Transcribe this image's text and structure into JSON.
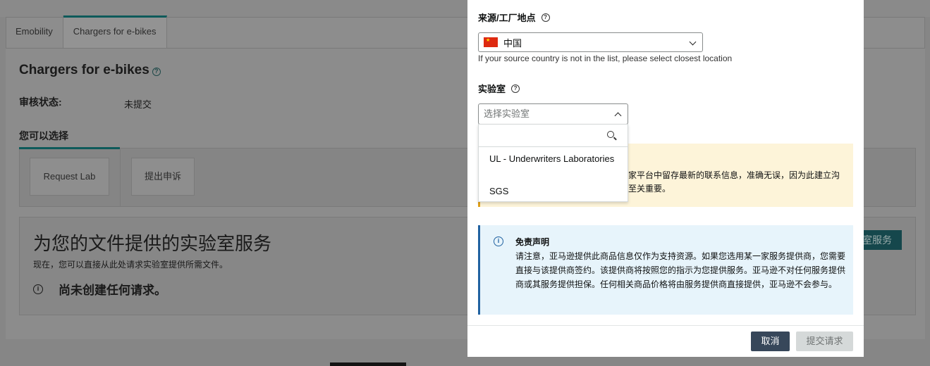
{
  "background": {
    "page_title": "",
    "tabs": [
      {
        "label": "Emobility"
      },
      {
        "label": "Chargers for e-bikes"
      }
    ],
    "heading": "Chargers for e-bikes",
    "review_status_label": "审核状态:",
    "review_status_value": "未提交",
    "you_can_choose": "您可以选择",
    "cards": [
      {
        "label": "Request Lab"
      },
      {
        "label": "提出申诉"
      }
    ],
    "lab_service_title": "为您的文件提供的实验室服务",
    "lab_service_subtitle": "现在，您可以直接从此处请求实验室提供所需文件。",
    "no_requests": "尚未创建任何请求。",
    "lab_service_button": "室服务"
  },
  "modal": {
    "source_label": "来源/工厂地点",
    "country_value": "中国",
    "country_hint": "If your source country is not in the list, please select closest location",
    "lab_label": "实验室",
    "lab_placeholder": "选择实验室",
    "lab_options": [
      {
        "label": "UL - Underwriters Laboratories"
      },
      {
        "label": "SGS"
      }
    ],
    "warning_text": "卖家平台中留存最新的联系信息，准确无误，因为此建立沟通至关重要。",
    "disclaimer_title": "免责声明",
    "disclaimer_body": "请注意，亚马逊提供此商品信息仅作为支持资源。如果您选用某一家服务提供商，您需要直接与该提供商签约。该提供商将按照您的指示为您提供服务。亚马逊不对任何服务提供商或其服务提供担保。任何相关商品价格将由服务提供商直接提供，亚马逊不会参与。",
    "cancel_label": "取消",
    "submit_label": "提交请求"
  },
  "colors": {
    "primary_dark": "#37475a",
    "warning_border": "#e2a21a",
    "info_border": "#2162a1",
    "teal": "#0e5a5a"
  }
}
